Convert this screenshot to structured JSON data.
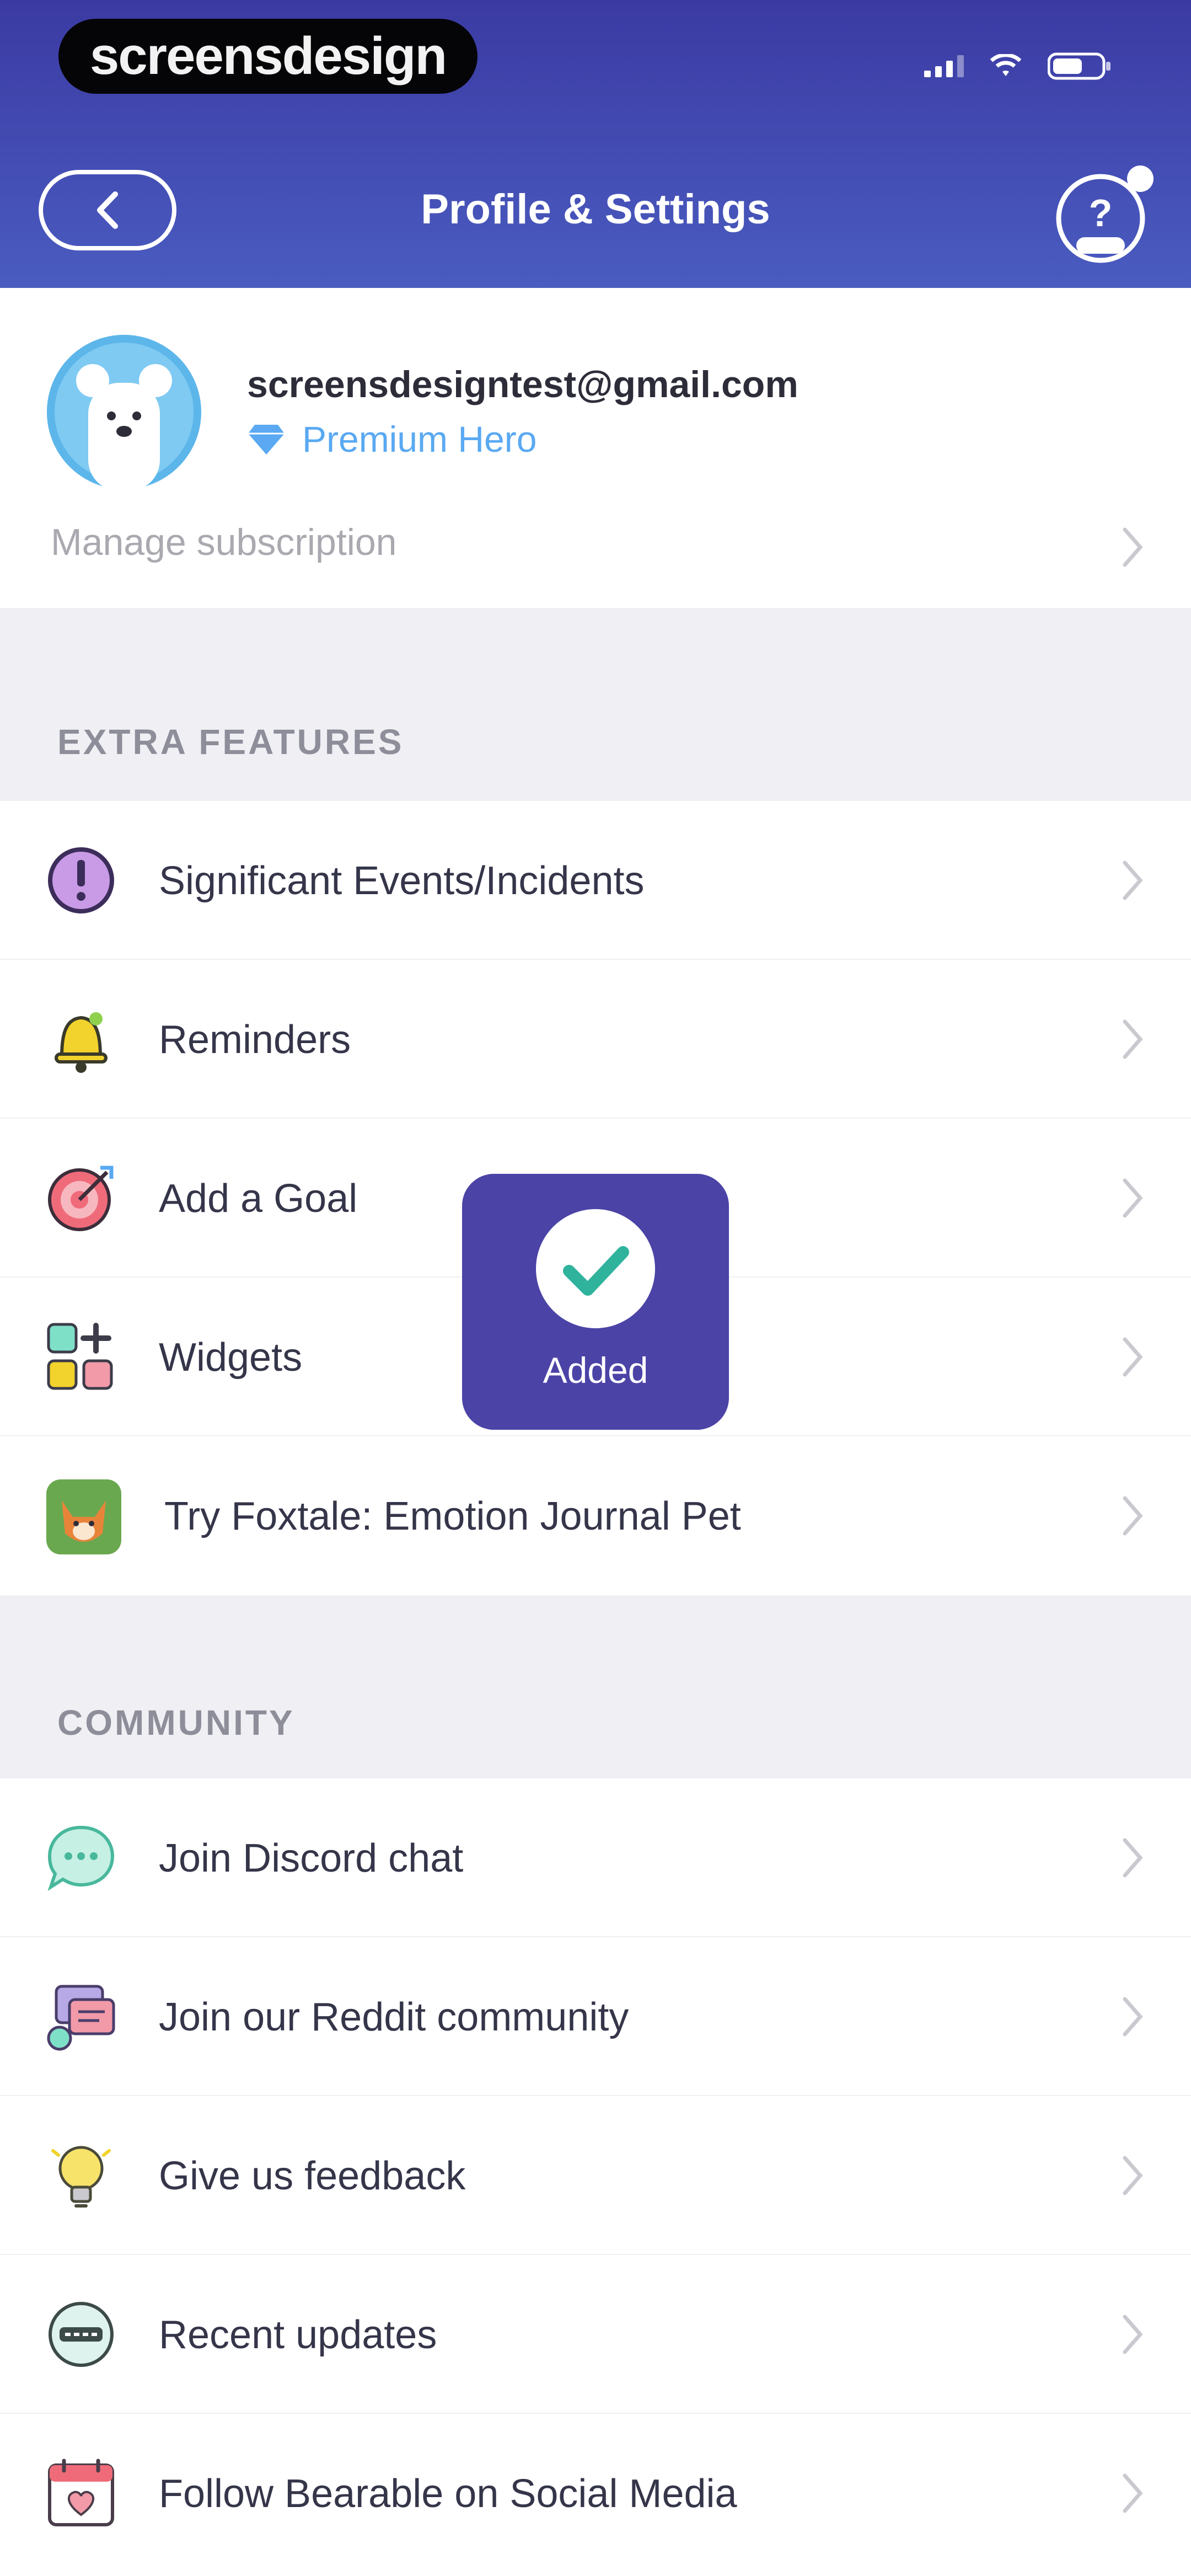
{
  "status_bar": {
    "watermark": "screensdesign"
  },
  "header": {
    "title": "Profile & Settings",
    "back_icon": "chevron-left-icon",
    "help_icon": "help-icon"
  },
  "profile": {
    "email": "screensdesigntest@gmail.com",
    "tier": "Premium Hero",
    "manage_label": "Manage subscription"
  },
  "sections": {
    "extra_features": {
      "title": "EXTRA FEATURES",
      "items": [
        {
          "label": "Significant Events/Incidents",
          "icon": "alert-icon"
        },
        {
          "label": "Reminders",
          "icon": "bell-icon"
        },
        {
          "label": "Add a Goal",
          "icon": "target-icon"
        },
        {
          "label": "Widgets",
          "icon": "widgets-icon"
        },
        {
          "label": "Try Foxtale: Emotion Journal Pet",
          "icon": "fox-icon"
        }
      ]
    },
    "community": {
      "title": "COMMUNITY",
      "items": [
        {
          "label": "Join Discord chat",
          "icon": "chat-icon"
        },
        {
          "label": "Join our Reddit community",
          "icon": "reddit-icon"
        },
        {
          "label": "Give us feedback",
          "icon": "lightbulb-icon"
        },
        {
          "label": "Recent updates",
          "icon": "news-icon"
        },
        {
          "label": "Follow Bearable on Social Media",
          "icon": "calendar-heart-icon"
        }
      ]
    }
  },
  "toast": {
    "label": "Added",
    "icon": "checkmark-icon"
  },
  "colors": {
    "header_top": "#3b3aa3",
    "header_bottom": "#4a5cc0",
    "accent": "#4b43a6",
    "premium": "#5aa9f2",
    "check": "#2fb39c"
  }
}
